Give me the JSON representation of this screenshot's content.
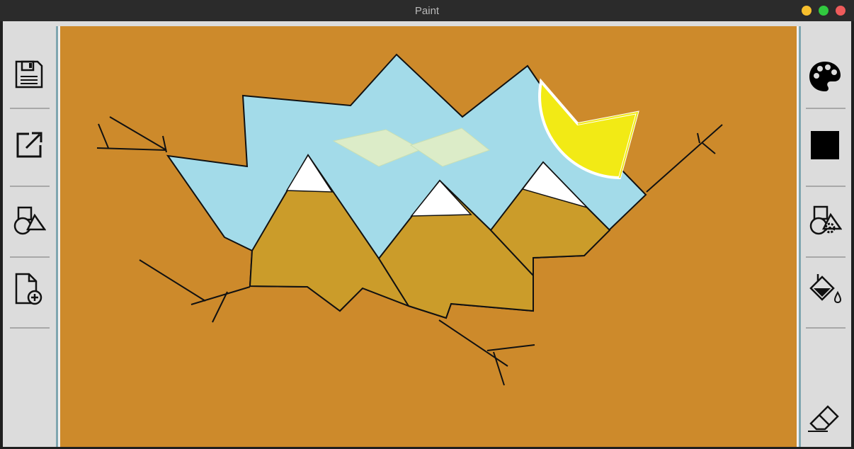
{
  "window": {
    "title": "Paint"
  },
  "toolbar_left": {
    "tools": [
      {
        "name": "save",
        "icon": "save-icon"
      },
      {
        "name": "export",
        "icon": "export-icon"
      },
      {
        "name": "shapes",
        "icon": "shapes-icon"
      },
      {
        "name": "new-file",
        "icon": "new-file-icon"
      }
    ]
  },
  "toolbar_right": {
    "tools": [
      {
        "name": "palette",
        "icon": "palette-icon"
      },
      {
        "name": "current-color",
        "icon": "color-swatch",
        "color": "#000000"
      },
      {
        "name": "shape-settings",
        "icon": "shape-settings-icon"
      },
      {
        "name": "fill",
        "icon": "paint-bucket-icon"
      },
      {
        "name": "eraser",
        "icon": "eraser-icon"
      }
    ]
  },
  "canvas": {
    "background": "#cd8a2b",
    "colors": {
      "sky": "#a3dbe9",
      "mountain": "#cb9c2a",
      "snow": "#ffffff",
      "sun": "#f2ea15",
      "cloud": "#dcecc8"
    }
  }
}
